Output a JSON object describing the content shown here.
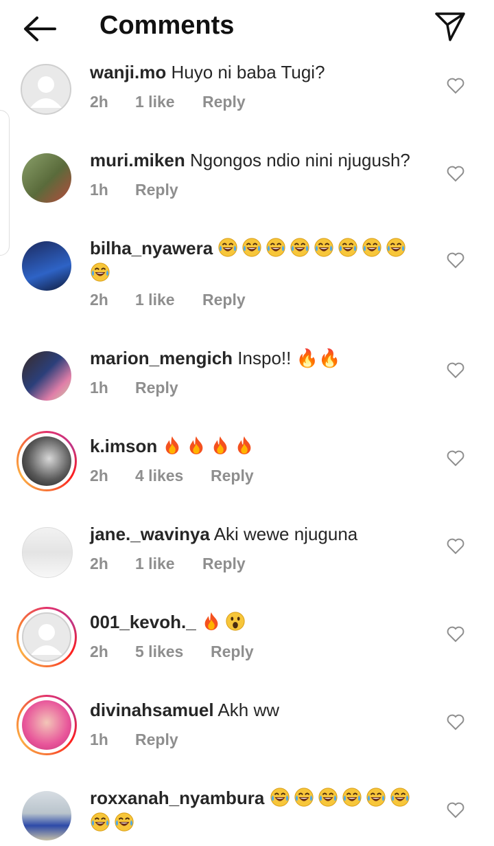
{
  "header": {
    "title": "Comments",
    "back_icon": "arrow-left-icon",
    "send_icon": "paper-plane-icon"
  },
  "colors": {
    "text": "#262626",
    "secondary": "#8e8e8e",
    "story_ring_start": "#e1306c",
    "story_ring_end": "#fcaf45"
  },
  "comments": [
    {
      "username": "wanji.mo",
      "text": "Huyo ni baba Tugi?",
      "time": "2h",
      "likes": "1 like",
      "reply": "Reply"
    },
    {
      "username": "muri.miken",
      "text": "Ngongos ndio nini njugush?",
      "time": "1h",
      "likes": "",
      "reply": "Reply"
    },
    {
      "username": "bilha_nyawera",
      "text": "😂😂😂😂😂😂😂😂😂",
      "time": "2h",
      "likes": "1 like",
      "reply": "Reply"
    },
    {
      "username": "marion_mengich",
      "text": "Inspo!! 🔥🔥",
      "time": "1h",
      "likes": "",
      "reply": "Reply"
    },
    {
      "username": "k.imson",
      "text": "🔥🔥🔥🔥",
      "time": "2h",
      "likes": "4 likes",
      "reply": "Reply"
    },
    {
      "username": "jane._wavinya",
      "text": "Aki wewe njuguna",
      "time": "2h",
      "likes": "1 like",
      "reply": "Reply"
    },
    {
      "username": "001_kevoh._",
      "text": "🔥😮",
      "time": "2h",
      "likes": "5 likes",
      "reply": "Reply"
    },
    {
      "username": "divinahsamuel",
      "text": "Akh ww",
      "time": "1h",
      "likes": "",
      "reply": "Reply"
    },
    {
      "username": "roxxanah_nyambura",
      "text": "😂😂😂😂😂😂😂😂",
      "time": "",
      "likes": "",
      "reply": ""
    }
  ]
}
